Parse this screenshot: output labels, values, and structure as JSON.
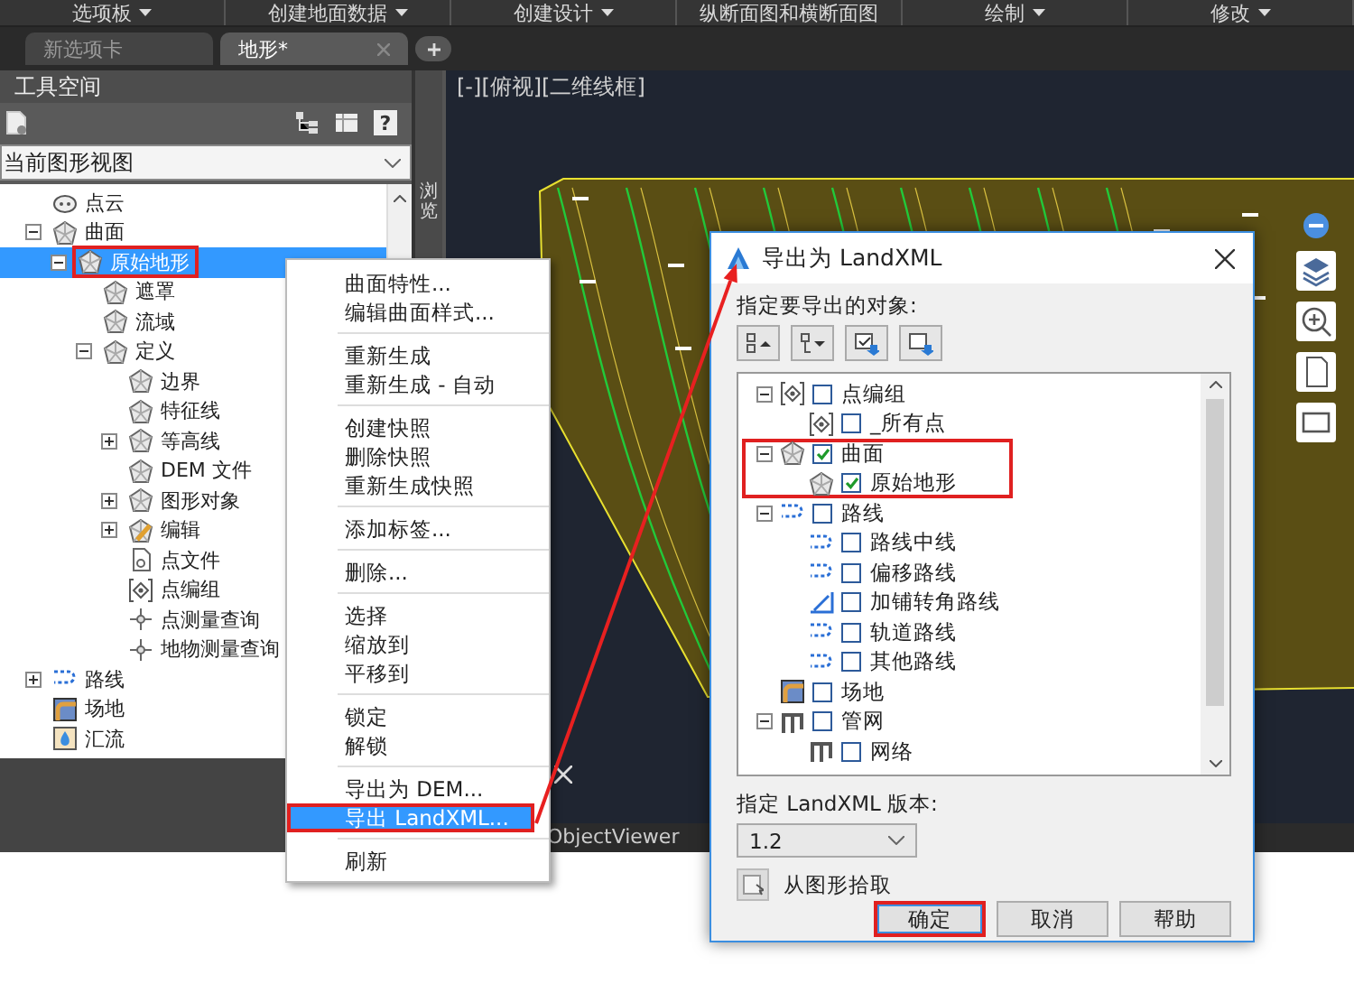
{
  "ribbon": {
    "panels": [
      {
        "label": "选项板",
        "has_menu": true
      },
      {
        "label": "创建地面数据",
        "has_menu": true
      },
      {
        "label": "创建设计",
        "has_menu": true
      },
      {
        "label": "纵断面图和横断面图",
        "has_menu": false
      },
      {
        "label": "绘制",
        "has_menu": true
      },
      {
        "label": "修改",
        "has_menu": true
      }
    ]
  },
  "document_tabs": [
    {
      "label": "新选项卡",
      "selected": false
    },
    {
      "label": "地形*",
      "selected": true
    }
  ],
  "toolspace": {
    "title": "工具空间",
    "help_button": "?",
    "view_selector": "当前图形视图",
    "side_tab": "浏览",
    "tree": [
      {
        "label": "点云",
        "kind": "cloud",
        "expandable": false,
        "selected": false,
        "marked": false
      },
      {
        "label": "曲面",
        "kind": "surface",
        "expandable": true,
        "expanded": true,
        "selected": false,
        "marked": false,
        "children": [
          {
            "label": "原始地形",
            "kind": "surface",
            "expandable": true,
            "expanded": true,
            "selected": true,
            "marked": true,
            "children": [
              {
                "label": "遮罩",
                "kind": "surface",
                "expandable": false,
                "selected": false,
                "marked": false
              },
              {
                "label": "流域",
                "kind": "surface",
                "expandable": false,
                "selected": false,
                "marked": false
              },
              {
                "label": "定义",
                "kind": "surface",
                "expandable": true,
                "expanded": true,
                "selected": false,
                "marked": false,
                "children": [
                  {
                    "label": "边界",
                    "kind": "surface",
                    "expandable": false,
                    "selected": false,
                    "marked": false
                  },
                  {
                    "label": "特征线",
                    "kind": "surface",
                    "expandable": false,
                    "selected": false,
                    "marked": false
                  },
                  {
                    "label": "等高线",
                    "kind": "surface",
                    "expandable": true,
                    "expanded": false,
                    "selected": false,
                    "marked": false
                  },
                  {
                    "label": "DEM 文件",
                    "kind": "surface",
                    "expandable": false,
                    "selected": false,
                    "marked": false
                  },
                  {
                    "label": "图形对象",
                    "kind": "surface",
                    "expandable": true,
                    "expanded": false,
                    "selected": false,
                    "marked": false
                  },
                  {
                    "label": "编辑",
                    "kind": "edit",
                    "expandable": true,
                    "expanded": false,
                    "selected": false,
                    "marked": false
                  },
                  {
                    "label": "点文件",
                    "kind": "document",
                    "expandable": false,
                    "selected": false,
                    "marked": false
                  },
                  {
                    "label": "点编组",
                    "kind": "point-group",
                    "expandable": false,
                    "selected": false,
                    "marked": false
                  },
                  {
                    "label": "点测量查询",
                    "kind": "query",
                    "expandable": false,
                    "selected": false,
                    "marked": false
                  },
                  {
                    "label": "地物测量查询",
                    "kind": "query",
                    "expandable": false,
                    "selected": false,
                    "marked": false
                  }
                ]
              }
            ]
          }
        ]
      },
      {
        "label": "路线",
        "kind": "alignment",
        "expandable": true,
        "expanded": false,
        "selected": false,
        "marked": false
      },
      {
        "label": "场地",
        "kind": "site",
        "expandable": false,
        "selected": false,
        "marked": false
      },
      {
        "label": "汇流",
        "kind": "catchment",
        "expandable": false,
        "selected": false,
        "marked": false
      }
    ]
  },
  "viewport": {
    "label": "[-][俯视][二维线框]",
    "command_line": "ObjectViewer"
  },
  "context_menu": {
    "groups": [
      [
        {
          "label": "曲面特性...",
          "selected": false,
          "marked": false
        },
        {
          "label": "编辑曲面样式...",
          "selected": false,
          "marked": false
        }
      ],
      [
        {
          "label": "重新生成",
          "selected": false,
          "marked": false
        },
        {
          "label": "重新生成 - 自动",
          "selected": false,
          "marked": false
        }
      ],
      [
        {
          "label": "创建快照",
          "selected": false,
          "marked": false
        },
        {
          "label": "删除快照",
          "selected": false,
          "marked": false
        },
        {
          "label": "重新生成快照",
          "selected": false,
          "marked": false
        }
      ],
      [
        {
          "label": "添加标签...",
          "selected": false,
          "marked": false
        }
      ],
      [
        {
          "label": "删除...",
          "selected": false,
          "marked": false
        }
      ],
      [
        {
          "label": "选择",
          "selected": false,
          "marked": false
        },
        {
          "label": "缩放到",
          "selected": false,
          "marked": false
        },
        {
          "label": "平移到",
          "selected": false,
          "marked": false
        }
      ],
      [
        {
          "label": "锁定",
          "selected": false,
          "marked": false
        },
        {
          "label": "解锁",
          "selected": false,
          "marked": false
        }
      ],
      [
        {
          "label": "导出为 DEM...",
          "selected": false,
          "marked": false
        },
        {
          "label": "导出 LandXML...",
          "selected": true,
          "marked": true
        }
      ],
      [
        {
          "label": "刷新",
          "selected": false,
          "marked": false
        }
      ]
    ]
  },
  "export_dialog": {
    "title": "导出为 LandXML",
    "objects_label": "指定要导出的对象:",
    "tree": [
      {
        "label": "点编组",
        "kind": "point-group",
        "expandable": true,
        "expanded": true,
        "checked": false,
        "marked": false,
        "children": [
          {
            "label": "_所有点",
            "kind": "point-group",
            "expandable": false,
            "checked": false,
            "marked": false
          }
        ]
      },
      {
        "label": "曲面",
        "kind": "surface",
        "expandable": true,
        "expanded": true,
        "checked": true,
        "marked": true,
        "children": [
          {
            "label": "原始地形",
            "kind": "surface",
            "expandable": false,
            "checked": true,
            "marked": false
          }
        ]
      },
      {
        "label": "路线",
        "kind": "alignment",
        "expandable": true,
        "expanded": true,
        "checked": false,
        "marked": false,
        "children": [
          {
            "label": "路线中线",
            "kind": "alignment",
            "expandable": false,
            "checked": false,
            "marked": false
          },
          {
            "label": "偏移路线",
            "kind": "alignment",
            "expandable": false,
            "checked": false,
            "marked": false
          },
          {
            "label": "加铺转角路线",
            "kind": "curb",
            "expandable": false,
            "checked": false,
            "marked": false
          },
          {
            "label": "轨道路线",
            "kind": "alignment",
            "expandable": false,
            "checked": false,
            "marked": false
          },
          {
            "label": "其他路线",
            "kind": "alignment",
            "expandable": false,
            "checked": false,
            "marked": false
          }
        ]
      },
      {
        "label": "场地",
        "kind": "site",
        "expandable": false,
        "checked": false,
        "marked": false
      },
      {
        "label": "管网",
        "kind": "pipe",
        "expandable": true,
        "expanded": true,
        "checked": false,
        "marked": false,
        "children": [
          {
            "label": "网络",
            "kind": "pipe",
            "expandable": false,
            "checked": false,
            "marked": false
          }
        ]
      }
    ],
    "version_label": "指定 LandXML 版本:",
    "version": "1.2",
    "pick_label": "从图形拾取",
    "buttons": [
      {
        "label": "确定",
        "default": true,
        "marked": true
      },
      {
        "label": "取消",
        "default": false,
        "marked": false
      },
      {
        "label": "帮助",
        "default": false,
        "marked": false
      }
    ]
  }
}
